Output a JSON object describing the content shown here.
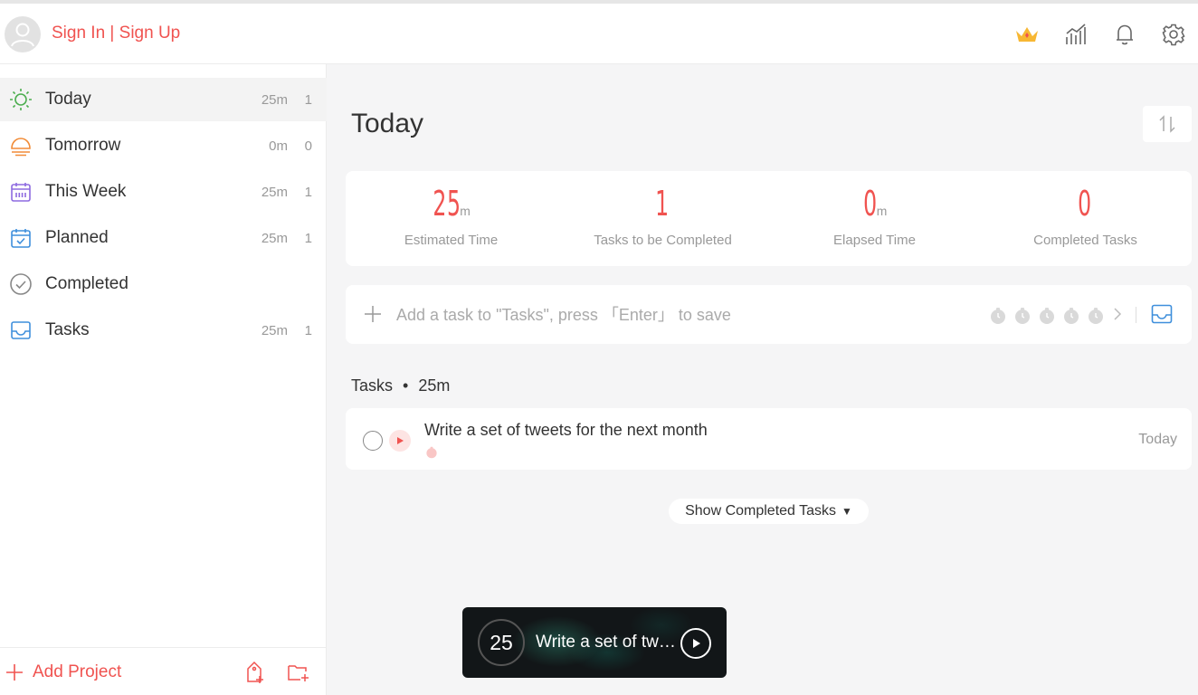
{
  "header": {
    "signin_label": "Sign In | Sign Up",
    "icons": [
      "crown-icon",
      "statistics-icon",
      "bell-icon",
      "gear-icon"
    ]
  },
  "sidebar": {
    "items": [
      {
        "label": "Today",
        "time": "25m",
        "count": "1",
        "icon": "sun-icon",
        "color": "#4cae4f",
        "active": true
      },
      {
        "label": "Tomorrow",
        "time": "0m",
        "count": "0",
        "icon": "sunrise-icon",
        "color": "#f28c38"
      },
      {
        "label": "This Week",
        "time": "25m",
        "count": "1",
        "icon": "calendar-week-icon",
        "color": "#8e6be0"
      },
      {
        "label": "Planned",
        "time": "25m",
        "count": "1",
        "icon": "calendar-check-icon",
        "color": "#3f8fdc"
      },
      {
        "label": "Completed",
        "time": "",
        "count": "",
        "icon": "check-circle-icon",
        "color": "#888888"
      },
      {
        "label": "Tasks",
        "time": "25m",
        "count": "1",
        "icon": "inbox-icon",
        "color": "#3f8fdc"
      }
    ],
    "add_project_label": "Add Project"
  },
  "main": {
    "title": "Today",
    "stats": [
      {
        "value": "25",
        "unit": "m",
        "label": "Estimated Time"
      },
      {
        "value": "1",
        "unit": "",
        "label": "Tasks to be Completed"
      },
      {
        "value": "0",
        "unit": "m",
        "label": "Elapsed Time"
      },
      {
        "value": "0",
        "unit": "",
        "label": "Completed Tasks"
      }
    ],
    "add_task_placeholder": "Add a task to \"Tasks\", press 「Enter」 to save",
    "section": {
      "name": "Tasks",
      "separator": "•",
      "time": "25m"
    },
    "tasks": [
      {
        "title": "Write a set of tweets for the next month",
        "date": "Today"
      }
    ],
    "show_completed_label": "Show Completed Tasks",
    "show_completed_caret": "▼"
  },
  "timer": {
    "minutes": "25",
    "title": "Write a set of tweets for the next month"
  },
  "colors": {
    "accent": "#f05350",
    "sidebar_active_bg": "#f3f3f3",
    "background": "#f5f5f6"
  }
}
